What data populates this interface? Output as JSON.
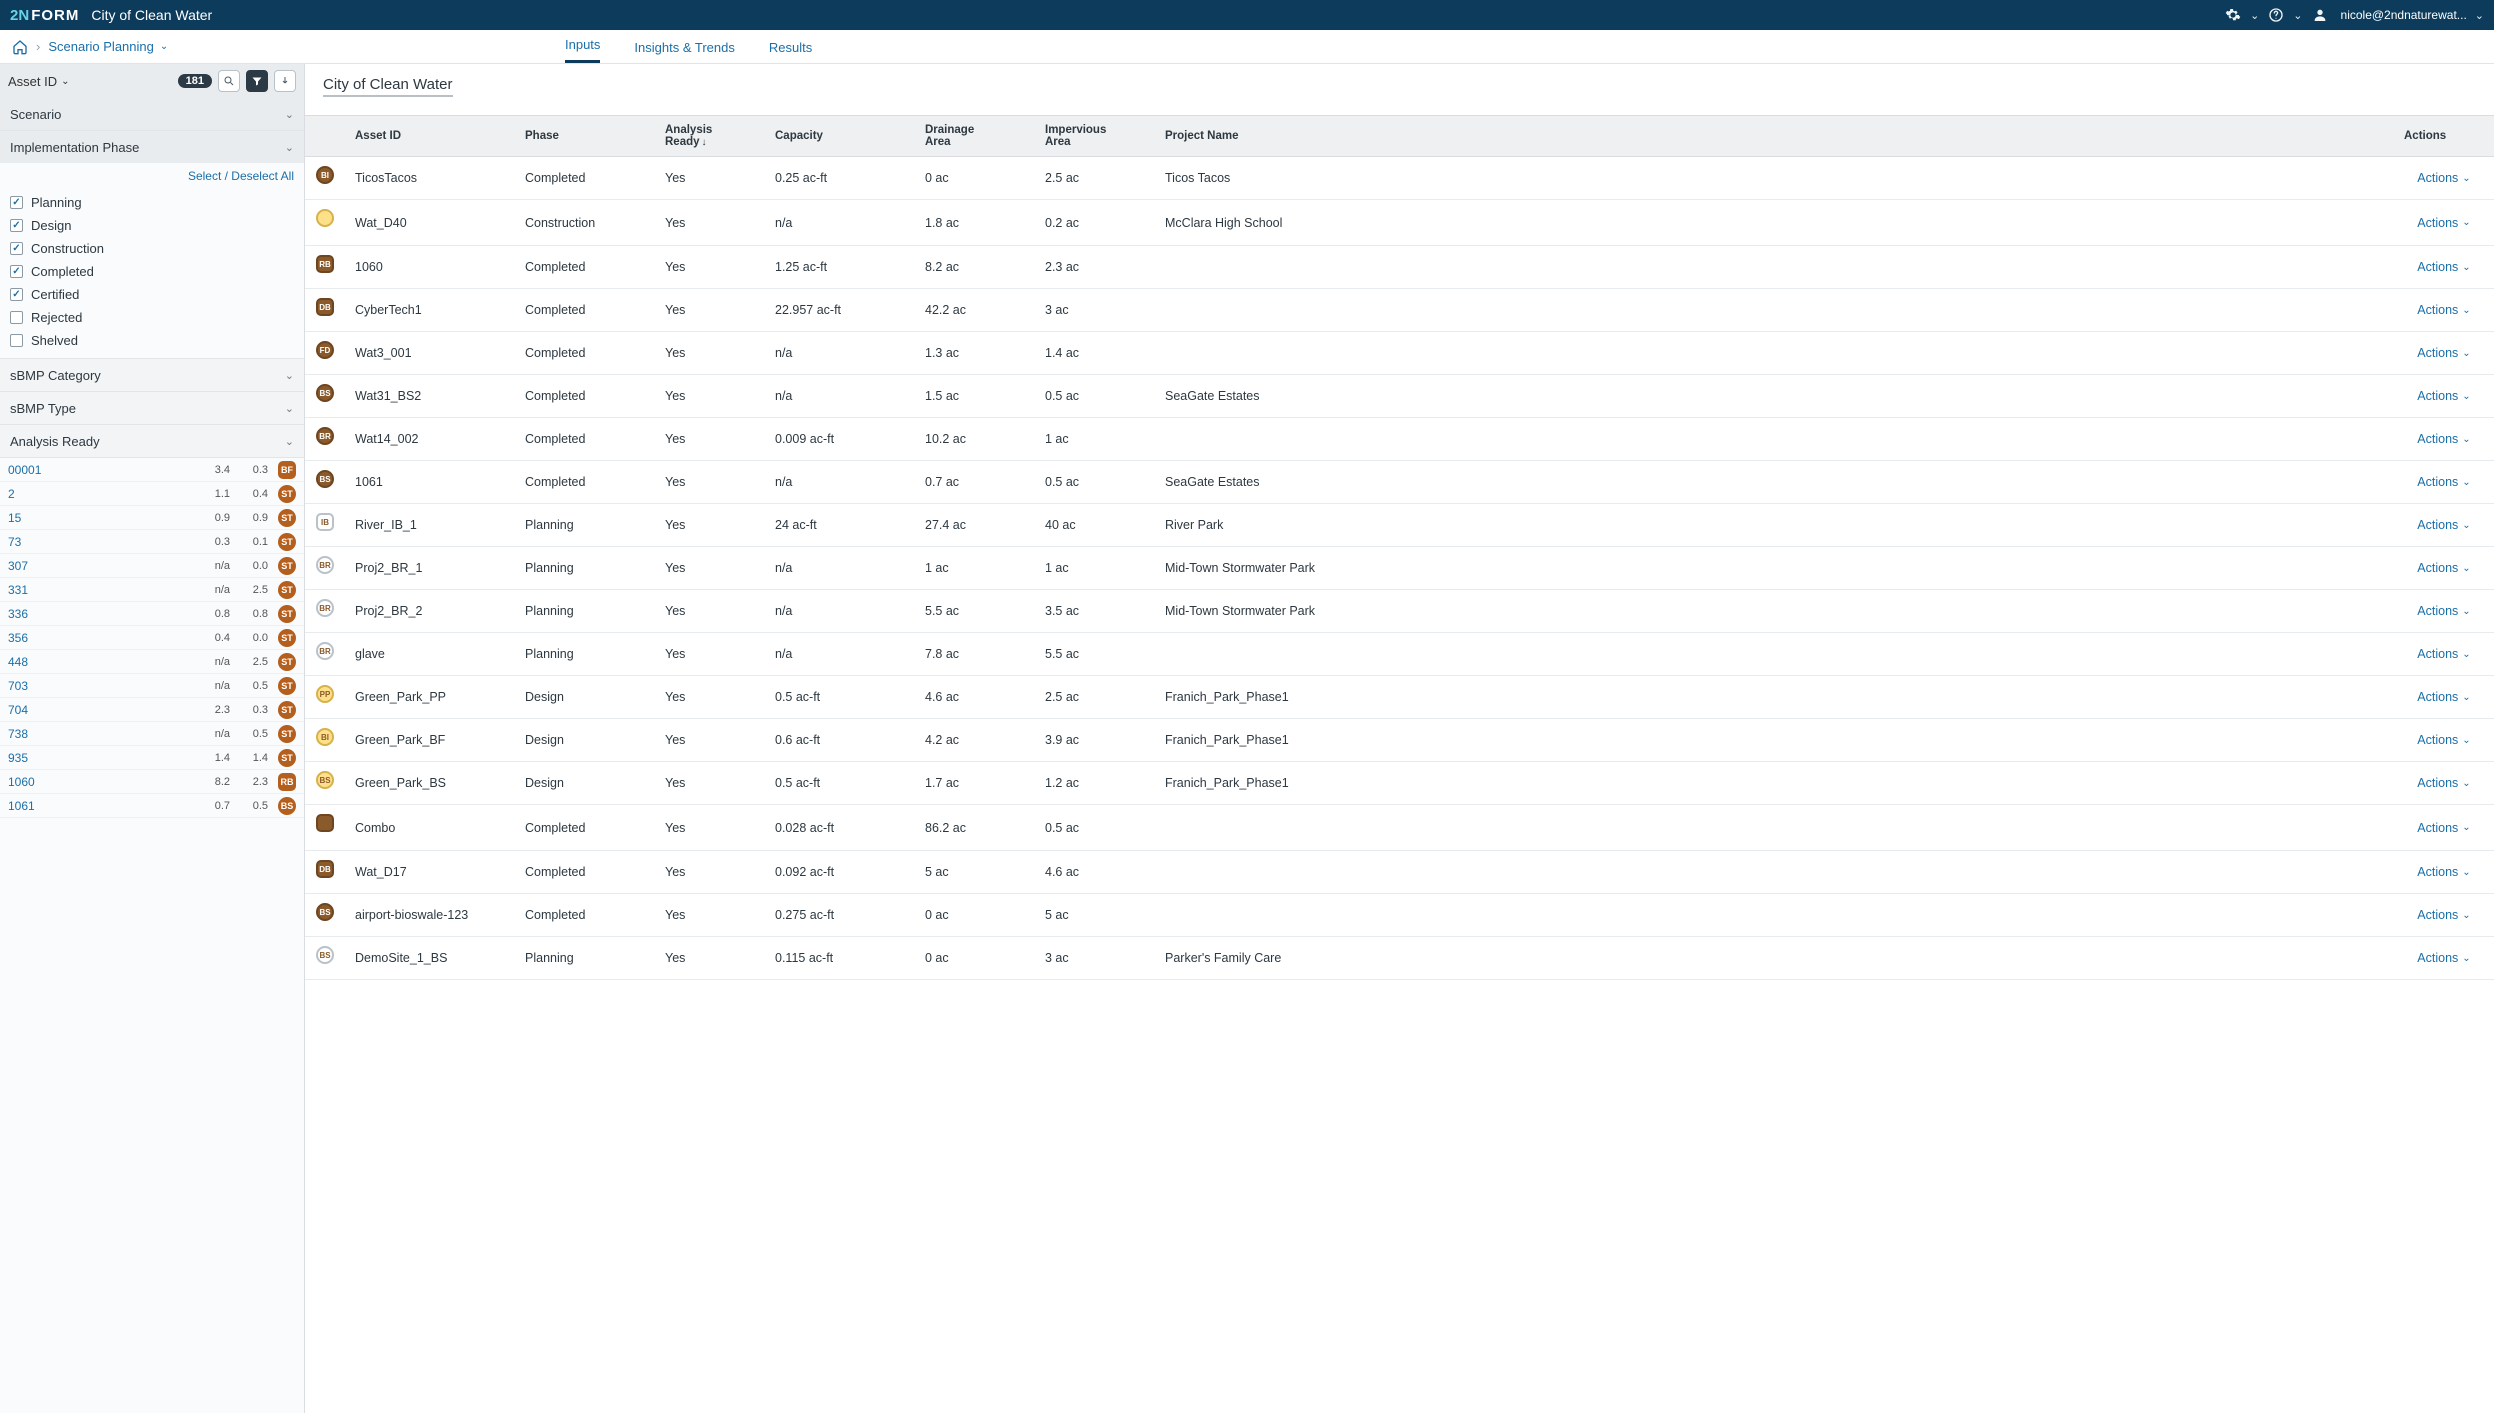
{
  "topbar": {
    "logo_prefix": "2N",
    "logo_suffix": "FORM",
    "city": "City of Clean Water",
    "user": "nicole@2ndnaturewat..."
  },
  "crumbs": {
    "current": "Scenario Planning"
  },
  "tabs": {
    "inputs": "Inputs",
    "insights": "Insights & Trends",
    "results": "Results"
  },
  "filterhead": {
    "label": "Asset ID",
    "count": "181"
  },
  "accordions": {
    "scenario": "Scenario",
    "phase": "Implementation Phase",
    "selall": "Select / Deselect All",
    "sbmp_cat": "sBMP Category",
    "sbmp_type": "sBMP Type",
    "analysis": "Analysis Ready"
  },
  "phase_checks": [
    {
      "label": "Planning",
      "checked": true
    },
    {
      "label": "Design",
      "checked": true
    },
    {
      "label": "Construction",
      "checked": true
    },
    {
      "label": "Completed",
      "checked": true
    },
    {
      "label": "Certified",
      "checked": true
    },
    {
      "label": "Rejected",
      "checked": false
    },
    {
      "label": "Shelved",
      "checked": false
    }
  ],
  "asset_rows": [
    {
      "id": "00001",
      "c1": "3.4",
      "c2": "0.3",
      "b": "BF",
      "shape": "square"
    },
    {
      "id": "2",
      "c1": "1.1",
      "c2": "0.4",
      "b": "ST",
      "shape": "round"
    },
    {
      "id": "15",
      "c1": "0.9",
      "c2": "0.9",
      "b": "ST",
      "shape": "round"
    },
    {
      "id": "73",
      "c1": "0.3",
      "c2": "0.1",
      "b": "ST",
      "shape": "round"
    },
    {
      "id": "307",
      "c1": "n/a",
      "c2": "0.0",
      "b": "ST",
      "shape": "round"
    },
    {
      "id": "331",
      "c1": "n/a",
      "c2": "2.5",
      "b": "ST",
      "shape": "round"
    },
    {
      "id": "336",
      "c1": "0.8",
      "c2": "0.8",
      "b": "ST",
      "shape": "round"
    },
    {
      "id": "356",
      "c1": "0.4",
      "c2": "0.0",
      "b": "ST",
      "shape": "round"
    },
    {
      "id": "448",
      "c1": "n/a",
      "c2": "2.5",
      "b": "ST",
      "shape": "round"
    },
    {
      "id": "703",
      "c1": "n/a",
      "c2": "0.5",
      "b": "ST",
      "shape": "round"
    },
    {
      "id": "704",
      "c1": "2.3",
      "c2": "0.3",
      "b": "ST",
      "shape": "round"
    },
    {
      "id": "738",
      "c1": "n/a",
      "c2": "0.5",
      "b": "ST",
      "shape": "round"
    },
    {
      "id": "935",
      "c1": "1.4",
      "c2": "1.4",
      "b": "ST",
      "shape": "round"
    },
    {
      "id": "1060",
      "c1": "8.2",
      "c2": "2.3",
      "b": "RB",
      "shape": "square"
    },
    {
      "id": "1061",
      "c1": "0.7",
      "c2": "0.5",
      "b": "BS",
      "shape": "round"
    }
  ],
  "page_title": "City of Clean Water",
  "columns": {
    "asset": "Asset ID",
    "phase": "Phase",
    "analysis": "Analysis",
    "ready": "Ready",
    "capacity": "Capacity",
    "drain1": "Drainage",
    "drain2": "Area",
    "imp1": "Impervious",
    "imp2": "Area",
    "project": "Project Name",
    "actions": "Actions",
    "action_label": "Actions"
  },
  "rows": [
    {
      "ic": "BI",
      "kind": "solid",
      "sh": "round",
      "asset": "TicosTacos",
      "phase": "Completed",
      "ready": "Yes",
      "cap": "0.25 ac-ft",
      "drain": "0 ac",
      "imp": "2.5 ac",
      "proj": "Ticos Tacos"
    },
    {
      "ic": "",
      "kind": "yellow",
      "sh": "round",
      "asset": "Wat_D40",
      "phase": "Construction",
      "ready": "Yes",
      "cap": "n/a",
      "drain": "1.8 ac",
      "imp": "0.2 ac",
      "proj": "McClara High School"
    },
    {
      "ic": "RB",
      "kind": "solid",
      "sh": "square",
      "asset": "1060",
      "phase": "Completed",
      "ready": "Yes",
      "cap": "1.25 ac-ft",
      "drain": "8.2 ac",
      "imp": "2.3 ac",
      "proj": ""
    },
    {
      "ic": "DB",
      "kind": "solid",
      "sh": "square",
      "asset": "CyberTech1",
      "phase": "Completed",
      "ready": "Yes",
      "cap": "22.957 ac-ft",
      "drain": "42.2 ac",
      "imp": "3 ac",
      "proj": ""
    },
    {
      "ic": "FD",
      "kind": "solid",
      "sh": "round",
      "asset": "Wat3_001",
      "phase": "Completed",
      "ready": "Yes",
      "cap": "n/a",
      "drain": "1.3 ac",
      "imp": "1.4 ac",
      "proj": ""
    },
    {
      "ic": "BS",
      "kind": "solid",
      "sh": "round",
      "asset": "Wat31_BS2",
      "phase": "Completed",
      "ready": "Yes",
      "cap": "n/a",
      "drain": "1.5 ac",
      "imp": "0.5 ac",
      "proj": "SeaGate Estates"
    },
    {
      "ic": "BR",
      "kind": "solid",
      "sh": "round",
      "asset": "Wat14_002",
      "phase": "Completed",
      "ready": "Yes",
      "cap": "0.009 ac-ft",
      "drain": "10.2 ac",
      "imp": "1 ac",
      "proj": ""
    },
    {
      "ic": "BS",
      "kind": "solid",
      "sh": "round",
      "asset": "1061",
      "phase": "Completed",
      "ready": "Yes",
      "cap": "n/a",
      "drain": "0.7 ac",
      "imp": "0.5 ac",
      "proj": "SeaGate Estates"
    },
    {
      "ic": "IB",
      "kind": "light",
      "sh": "square",
      "asset": "River_IB_1",
      "phase": "Planning",
      "ready": "Yes",
      "cap": "24 ac-ft",
      "drain": "27.4 ac",
      "imp": "40 ac",
      "proj": "River Park"
    },
    {
      "ic": "BR",
      "kind": "light",
      "sh": "round",
      "asset": "Proj2_BR_1",
      "phase": "Planning",
      "ready": "Yes",
      "cap": "n/a",
      "drain": "1 ac",
      "imp": "1 ac",
      "proj": "Mid-Town Stormwater Park"
    },
    {
      "ic": "BR",
      "kind": "light",
      "sh": "round",
      "asset": "Proj2_BR_2",
      "phase": "Planning",
      "ready": "Yes",
      "cap": "n/a",
      "drain": "5.5 ac",
      "imp": "3.5 ac",
      "proj": "Mid-Town Stormwater Park"
    },
    {
      "ic": "BR",
      "kind": "light",
      "sh": "round",
      "asset": "glave",
      "phase": "Planning",
      "ready": "Yes",
      "cap": "n/a",
      "drain": "7.8 ac",
      "imp": "5.5 ac",
      "proj": ""
    },
    {
      "ic": "PP",
      "kind": "yellow",
      "sh": "round",
      "asset": "Green_Park_PP",
      "phase": "Design",
      "ready": "Yes",
      "cap": "0.5 ac-ft",
      "drain": "4.6 ac",
      "imp": "2.5 ac",
      "proj": "Franich_Park_Phase1"
    },
    {
      "ic": "BI",
      "kind": "yellow",
      "sh": "round",
      "asset": "Green_Park_BF",
      "phase": "Design",
      "ready": "Yes",
      "cap": "0.6 ac-ft",
      "drain": "4.2 ac",
      "imp": "3.9 ac",
      "proj": "Franich_Park_Phase1"
    },
    {
      "ic": "BS",
      "kind": "yellow",
      "sh": "round",
      "asset": "Green_Park_BS",
      "phase": "Design",
      "ready": "Yes",
      "cap": "0.5 ac-ft",
      "drain": "1.7 ac",
      "imp": "1.2 ac",
      "proj": "Franich_Park_Phase1"
    },
    {
      "ic": "",
      "kind": "solid",
      "sh": "square",
      "asset": "Combo",
      "phase": "Completed",
      "ready": "Yes",
      "cap": "0.028 ac-ft",
      "drain": "86.2 ac",
      "imp": "0.5 ac",
      "proj": ""
    },
    {
      "ic": "DB",
      "kind": "solid",
      "sh": "square",
      "asset": "Wat_D17",
      "phase": "Completed",
      "ready": "Yes",
      "cap": "0.092 ac-ft",
      "drain": "5 ac",
      "imp": "4.6 ac",
      "proj": ""
    },
    {
      "ic": "BS",
      "kind": "solid",
      "sh": "round",
      "asset": "airport-bioswale-123",
      "phase": "Completed",
      "ready": "Yes",
      "cap": "0.275 ac-ft",
      "drain": "0 ac",
      "imp": "5 ac",
      "proj": ""
    },
    {
      "ic": "BS",
      "kind": "light",
      "sh": "round",
      "asset": "DemoSite_1_BS",
      "phase": "Planning",
      "ready": "Yes",
      "cap": "0.115 ac-ft",
      "drain": "0 ac",
      "imp": "3 ac",
      "proj": "Parker's Family Care"
    }
  ]
}
